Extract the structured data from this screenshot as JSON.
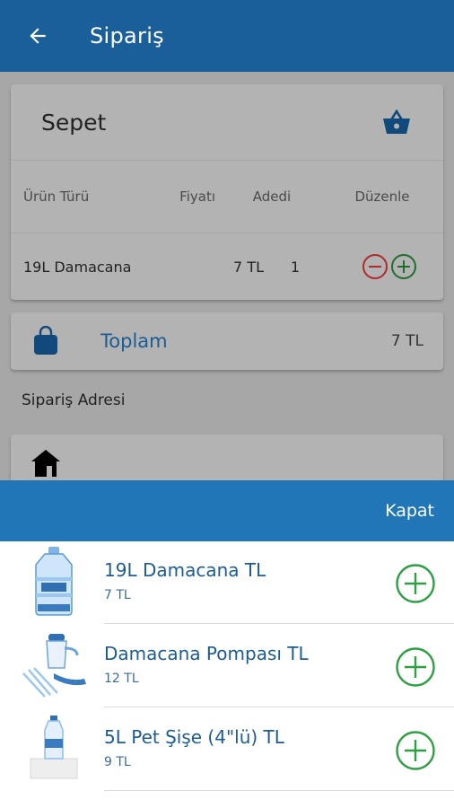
{
  "appbar": {
    "title": "Sipariş",
    "back_icon": "arrow-left-icon"
  },
  "cart": {
    "title": "Sepet",
    "icon": "basket-icon",
    "columns": [
      "Ürün Türü",
      "Fiyatı",
      "Adedi",
      "Düzenle"
    ],
    "rows": [
      {
        "name": "19L Damacana",
        "price": "7 TL",
        "qty": "1"
      }
    ]
  },
  "total": {
    "label": "Toplam",
    "value": "7 TL",
    "icon": "shopping-bag-icon"
  },
  "address": {
    "label": "Sipariş Adresi",
    "icon": "home-icon"
  },
  "sheet": {
    "close_label": "Kapat",
    "products": [
      {
        "name": "19L Damacana TL",
        "price": "7 TL",
        "image": "water-bottle-19l"
      },
      {
        "name": "Damacana Pompası TL",
        "price": "12 TL",
        "image": "water-pump"
      },
      {
        "name": "5L Pet Şişe (4\"lü) TL",
        "price": "9 TL",
        "image": "pet-bottle-5l"
      }
    ]
  },
  "colors": {
    "primary": "#1a5f99",
    "sheet_bar": "#2176b7",
    "add_green": "#2ea043",
    "remove_red": "#d03a3a"
  }
}
